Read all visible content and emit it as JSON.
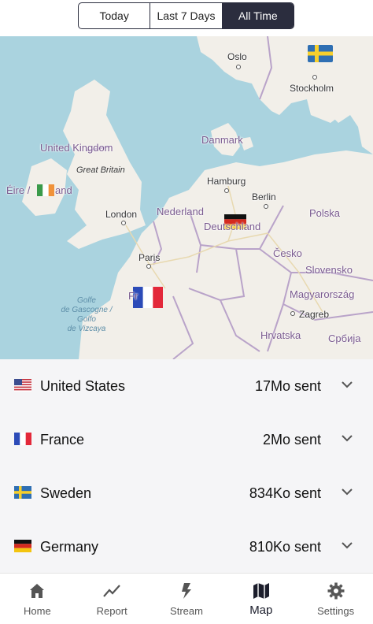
{
  "segmented": {
    "options": [
      "Today",
      "Last 7 Days",
      "All Time"
    ],
    "selected": "All Time"
  },
  "map": {
    "cities": {
      "oslo": "Oslo",
      "stockholm": "Stockholm",
      "london": "London",
      "paris": "Paris",
      "hamburg": "Hamburg",
      "berlin": "Berlin",
      "zagreb": "Zagreb"
    },
    "countries": {
      "uk": "United Kingdom",
      "ireland_prefix": "Éire /",
      "ireland_suffix": "and",
      "danmark": "Danmark",
      "nederland": "Nederland",
      "deutschland": "Deutschland",
      "polska": "Polska",
      "cesko": "Česko",
      "slovensko": "Slovensko",
      "magyarorszag": "Magyarország",
      "hrvatska": "Hrvatska",
      "srbija": "Србија",
      "france": "Fr"
    },
    "island": "Great Britain",
    "sea": [
      "Golfe",
      "de Gascogne /",
      "Golfo",
      "de Vizcaya"
    ],
    "flags": [
      "sweden",
      "ireland",
      "germany",
      "france"
    ]
  },
  "countries": [
    {
      "flag": "us-flag",
      "name": "United States",
      "sent": "17Mo sent"
    },
    {
      "flag": "fr-flag",
      "name": "France",
      "sent": "2Mo sent"
    },
    {
      "flag": "se-flag",
      "name": "Sweden",
      "sent": "834Ko sent"
    },
    {
      "flag": "de-flag",
      "name": "Germany",
      "sent": "810Ko sent"
    }
  ],
  "tabs": [
    {
      "icon": "home-icon",
      "label": "Home"
    },
    {
      "icon": "chart-icon",
      "label": "Report"
    },
    {
      "icon": "bolt-icon",
      "label": "Stream"
    },
    {
      "icon": "map-icon",
      "label": "Map"
    },
    {
      "icon": "gear-icon",
      "label": "Settings"
    }
  ],
  "active_tab": "Map",
  "colors": {
    "accent": "#2b2d3e",
    "water": "#aad3df",
    "land": "#f2efe9",
    "border": "#b9a3c9"
  }
}
